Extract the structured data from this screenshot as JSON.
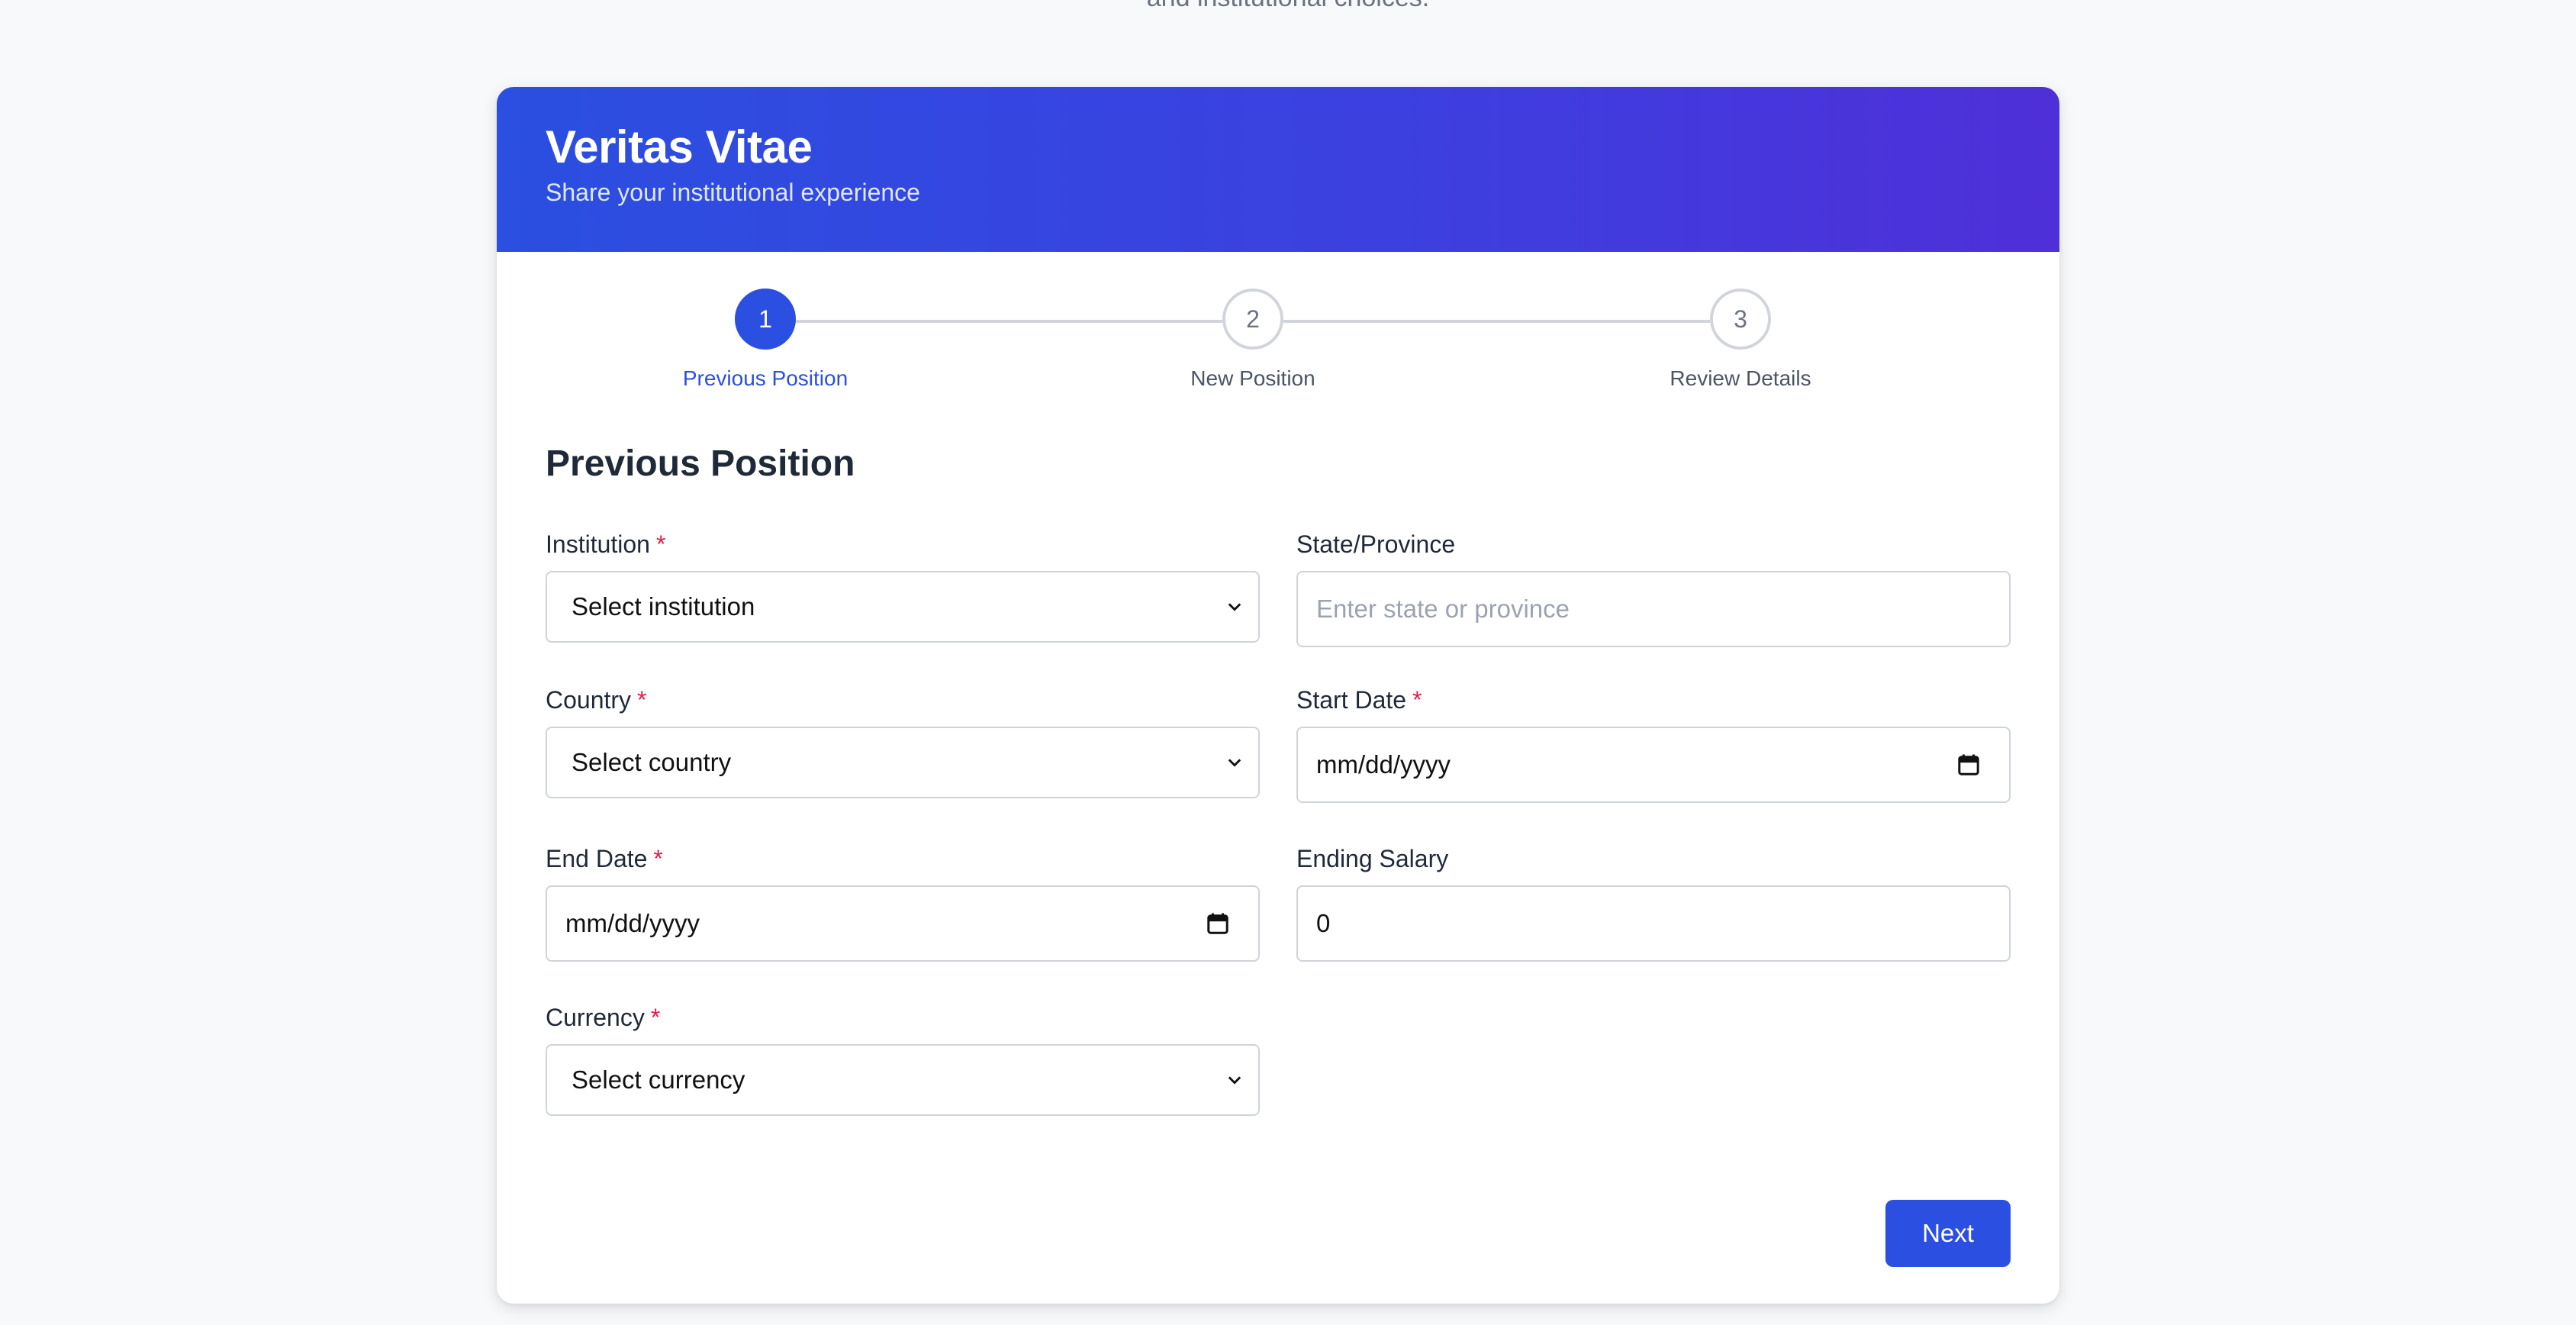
{
  "page": {
    "top_text": "and institutional choices."
  },
  "header": {
    "title": "Veritas Vitae",
    "subtitle": "Share your institutional experience"
  },
  "stepper": {
    "steps": [
      {
        "number": "1",
        "label": "Previous Position",
        "active": true
      },
      {
        "number": "2",
        "label": "New Position",
        "active": false
      },
      {
        "number": "3",
        "label": "Review Details",
        "active": false
      }
    ]
  },
  "form": {
    "section_title": "Previous Position",
    "required_mark": "*",
    "institution": {
      "label": "Institution",
      "value": "Select institution"
    },
    "state": {
      "label": "State/Province",
      "placeholder": "Enter state or province"
    },
    "country": {
      "label": "Country",
      "value": "Select country"
    },
    "start_date": {
      "label": "Start Date",
      "value": "mm/dd/yyyy"
    },
    "end_date": {
      "label": "End Date",
      "value": "mm/dd/yyyy"
    },
    "ending_salary": {
      "label": "Ending Salary",
      "value": "0"
    },
    "currency": {
      "label": "Currency",
      "value": "Select currency"
    }
  },
  "actions": {
    "next_label": "Next"
  },
  "colors": {
    "accent": "#2b4fe0",
    "header_gradient_end": "#4f2fd8",
    "required": "#e11d48"
  }
}
